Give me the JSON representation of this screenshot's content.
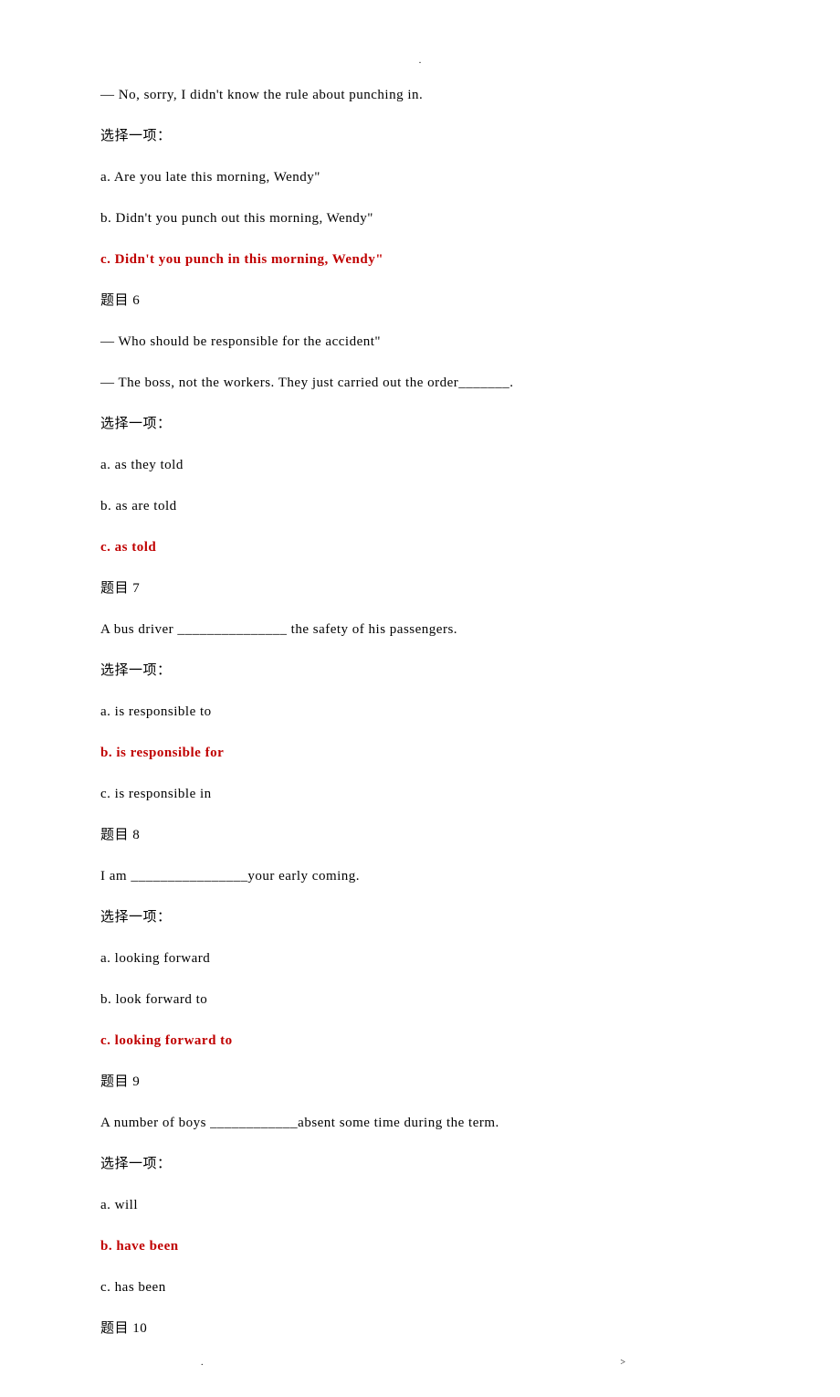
{
  "header_mark": ".",
  "lines": [
    {
      "text": "— No, sorry, I didn't know the rule about punching in.",
      "answer": false
    },
    {
      "text": "选择一项：",
      "answer": false
    },
    {
      "text": "a. Are you late this morning, Wendy\"",
      "answer": false
    },
    {
      "text": "b. Didn't you punch out this morning, Wendy\"",
      "answer": false
    },
    {
      "text": "c. Didn't you punch in this morning, Wendy\"",
      "answer": true
    },
    {
      "text": "题目 6",
      "answer": false
    },
    {
      "text": "— Who should be responsible for the accident\"",
      "answer": false
    },
    {
      "text": "— The boss, not the workers. They just carried out the order_______.",
      "answer": false
    },
    {
      "text": "选择一项：",
      "answer": false
    },
    {
      "text": "a. as they told",
      "answer": false
    },
    {
      "text": "b. as are told",
      "answer": false
    },
    {
      "text": "c. as told",
      "answer": true
    },
    {
      "text": "题目 7",
      "answer": false
    },
    {
      "text": "A bus driver _______________ the safety of his passengers.",
      "answer": false
    },
    {
      "text": "选择一项：",
      "answer": false
    },
    {
      "text": "a. is responsible to",
      "answer": false
    },
    {
      "text": "b. is responsible for",
      "answer": true
    },
    {
      "text": "c. is responsible in",
      "answer": false
    },
    {
      "text": "题目 8",
      "answer": false
    },
    {
      "text": "I am ________________your early coming.",
      "answer": false
    },
    {
      "text": "选择一项：",
      "answer": false
    },
    {
      "text": "a. looking forward",
      "answer": false
    },
    {
      "text": "b. look forward to",
      "answer": false
    },
    {
      "text": "c. looking forward to",
      "answer": true
    },
    {
      "text": "题目 9",
      "answer": false
    },
    {
      "text": "A number of boys ____________absent some time during the term.",
      "answer": false
    },
    {
      "text": "选择一项：",
      "answer": false
    },
    {
      "text": "a. will",
      "answer": false
    },
    {
      "text": "b. have been",
      "answer": true
    },
    {
      "text": "c. has been",
      "answer": false
    },
    {
      "text": "题目 10",
      "answer": false
    }
  ],
  "footer_left": ".",
  "footer_right": ">"
}
